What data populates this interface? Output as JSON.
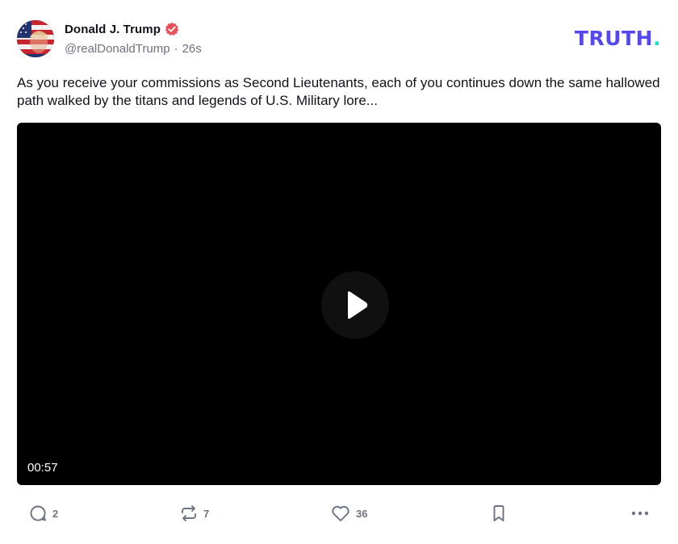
{
  "post": {
    "author_name": "Donald J. Trump",
    "handle": "@realDonaldTrump",
    "separator": "·",
    "time_ago": "26s",
    "body": "As you receive your commissions as Second Lieutenants, each of you continues down the same hallowed path walked by the titans and legends of U.S. Military lore...",
    "video": {
      "duration": "00:57"
    },
    "counts": {
      "replies": "2",
      "retruths": "7",
      "likes": "36"
    }
  },
  "brand": {
    "logo_text": "TRUTH",
    "logo_dot": ".",
    "primary_color": "#5448ee",
    "accent_color": "#17e3c3",
    "verified_color": "#e8505b"
  },
  "icons": {
    "avatar": "flag-portrait-avatar",
    "verified": "verified-badge-icon",
    "play": "play-icon",
    "reply": "comment-icon",
    "retruth": "repost-icon",
    "like": "heart-icon",
    "bookmark": "bookmark-icon",
    "more": "more-icon"
  }
}
